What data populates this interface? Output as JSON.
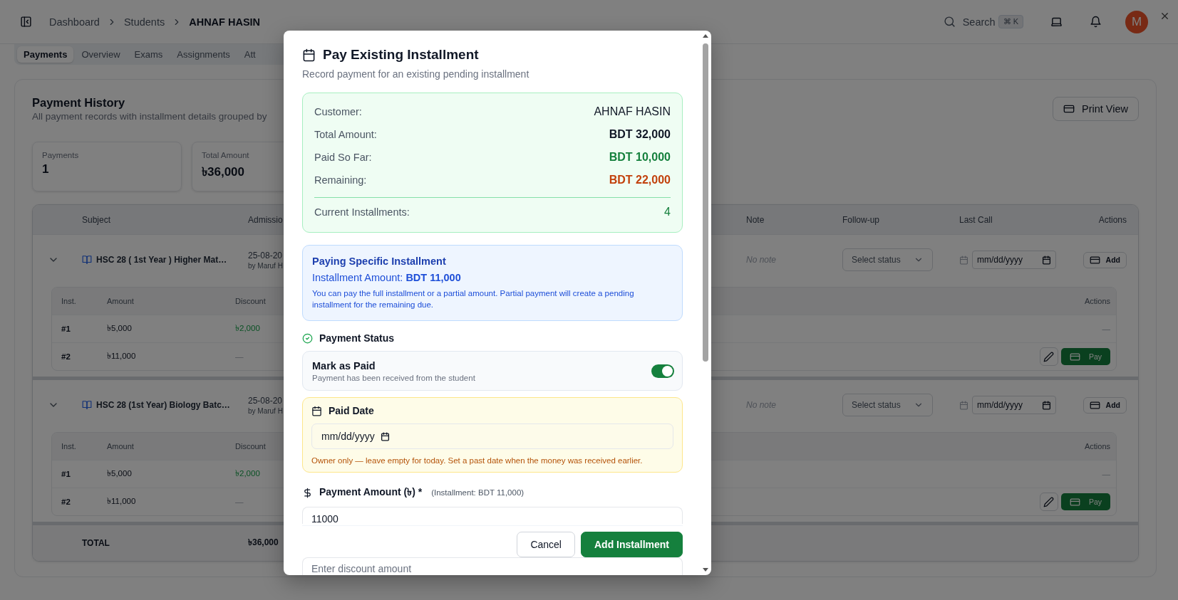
{
  "header": {
    "breadcrumb": [
      "Dashboard",
      "Students",
      "AHNAF HASIN"
    ],
    "search": {
      "label": "Search",
      "shortcut": "⌘ K"
    },
    "avatar": {
      "initial": "M"
    }
  },
  "tabs": [
    {
      "label": "Payments",
      "selected": true
    },
    {
      "label": "Overview",
      "selected": false
    },
    {
      "label": "Exams",
      "selected": false
    },
    {
      "label": "Assignments",
      "selected": false
    },
    {
      "label": "Att",
      "selected": false
    }
  ],
  "payment_history": {
    "title": "Payment History",
    "subtitle": "All payment records with installment details grouped by",
    "print_button": "Print View",
    "stats": [
      {
        "label": "Payments",
        "value": "1"
      },
      {
        "label": "Total Amount",
        "value": "৳36,000"
      }
    ],
    "table": {
      "columns_left": [
        "Subject",
        "Admissio"
      ],
      "columns_right": [
        "Note",
        "Follow-up",
        "Last Call",
        "Actions"
      ],
      "groups": [
        {
          "expanded": true,
          "subject": "HSC 28 ( 1st Year ) Higher Mat…",
          "date": "25-08-20",
          "by": "by Maruf H",
          "note": "No note",
          "follow_up": "Select status",
          "last_call": "mm/dd/yyyy",
          "add_button": "Add",
          "installments": {
            "columns": [
              "Inst.",
              "Amount",
              "Discount",
              "Actions"
            ],
            "rows": [
              {
                "inst": "#1",
                "amount": "৳5,000",
                "discount": "৳2,000",
                "action": "—"
              },
              {
                "inst": "#2",
                "amount": "৳11,000",
                "discount": "—",
                "pay_button": "Pay"
              }
            ]
          }
        },
        {
          "expanded": true,
          "subject": "HSC 28 (1st Year) Biology Batc…",
          "date": "25-08-20",
          "by": "by Maruf H",
          "note": "No note",
          "follow_up": "Select status",
          "last_call": "mm/dd/yyyy",
          "add_button": "Add",
          "installments": {
            "columns": [
              "Inst.",
              "Amount",
              "Discount",
              "Actions"
            ],
            "rows": [
              {
                "inst": "#1",
                "amount": "৳5,000",
                "discount": "৳2,000",
                "action": "—"
              },
              {
                "inst": "#2",
                "amount": "৳11,000",
                "discount": "—",
                "pay_button": "Pay"
              }
            ]
          }
        }
      ],
      "total": {
        "label": "TOTAL",
        "amount": "৳36,000"
      }
    }
  },
  "modal": {
    "title": "Pay Existing Installment",
    "subtitle": "Record payment for an existing pending installment",
    "summary": [
      {
        "label": "Customer:",
        "value": "AHNAF HASIN",
        "kind": "plain"
      },
      {
        "label": "Total Amount:",
        "value": "BDT 32,000",
        "kind": "bold"
      },
      {
        "label": "Paid So Far:",
        "value": "BDT 10,000",
        "kind": "paid"
      },
      {
        "label": "Remaining:",
        "value": "BDT 22,000",
        "kind": "due"
      }
    ],
    "current_installments": {
      "label": "Current Installments:",
      "value": "4"
    },
    "installment_info": {
      "title": "Paying Specific Installment",
      "amount": "Installment Amount: **BDT 11,000**",
      "note": "You can pay the full installment or a partial amount. Partial payment will create a pending installment for the remaining due."
    },
    "payment_status": {
      "heading": "Payment Status",
      "toggle_label": "Mark as Paid",
      "toggle_hint": "Payment has been received from the student",
      "on": true
    },
    "paid_date": {
      "heading": "Paid Date",
      "placeholder": "mm/dd/yyyy",
      "hint": "Owner only — leave empty for today. Set a past date when the money was received earlier."
    },
    "payment_amount": {
      "label": "Payment Amount (৳) *",
      "hint": "(Installment: BDT 11,000)",
      "value": "11000"
    },
    "buttons": [
      {
        "label": "Cancel",
        "kind": "secondary"
      },
      {
        "label": "Add Installment",
        "kind": "primary"
      }
    ],
    "discount": {
      "placeholder": "Enter discount amount"
    }
  }
}
